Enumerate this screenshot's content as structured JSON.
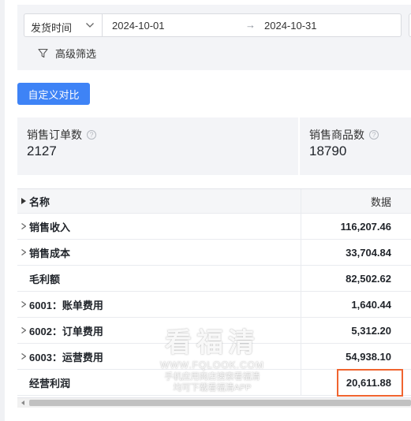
{
  "filters": {
    "date_type": "发货时间",
    "start_date": "2024-10-01",
    "end_date": "2024-10-31",
    "range_arrow": "→",
    "advanced_filter": "高级筛选"
  },
  "compare_button": "自定义对比",
  "kpis": [
    {
      "title": "销售订单数",
      "value": "2127"
    },
    {
      "title": "销售商品数",
      "value": "18790"
    }
  ],
  "table": {
    "headers": {
      "name": "名称",
      "data": "数据"
    },
    "rows": [
      {
        "name": "销售收入",
        "value": "116,207.46",
        "expandable": true
      },
      {
        "name": "销售成本",
        "value": "33,704.84",
        "expandable": true
      },
      {
        "name": "毛利额",
        "value": "82,502.62",
        "expandable": false
      },
      {
        "name": "6001：账单费用",
        "value": "1,640.44",
        "expandable": true
      },
      {
        "name": "6002：订单费用",
        "value": "5,312.20",
        "expandable": true
      },
      {
        "name": "6003：运营费用",
        "value": "54,938.10",
        "expandable": true
      },
      {
        "name": "经营利润",
        "value": "20,611.88",
        "expandable": false
      }
    ]
  },
  "watermark": {
    "line1": "看福清",
    "line2": "WWW.FQLOOK.COM",
    "line3": "手机应用商店搜索看福清",
    "line4": "均可下载看福清APP"
  },
  "colors": {
    "primary": "#3e83f6",
    "highlight_border": "#f0642f",
    "panel_bg": "#f3f4f7"
  }
}
